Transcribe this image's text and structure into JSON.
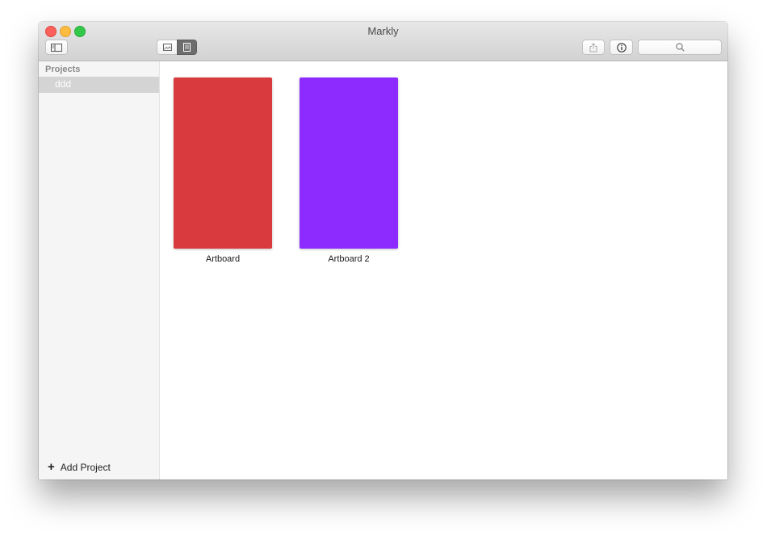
{
  "window": {
    "title": "Markly"
  },
  "toolbar": {
    "sidebar_toggle_icon": "sidebar-icon",
    "view_image_icon": "image-icon",
    "view_document_icon": "document-icon",
    "share_icon": "share-icon",
    "info_icon": "info-icon",
    "search_icon": "search-icon",
    "search_placeholder": ""
  },
  "sidebar": {
    "header": "Projects",
    "items": [
      {
        "label": "ddd",
        "selected": true
      }
    ],
    "add_label": "Add Project"
  },
  "artboards": [
    {
      "label": "Artboard",
      "color": "#d93a3d"
    },
    {
      "label": "Artboard 2",
      "color": "#8d2bff"
    }
  ]
}
